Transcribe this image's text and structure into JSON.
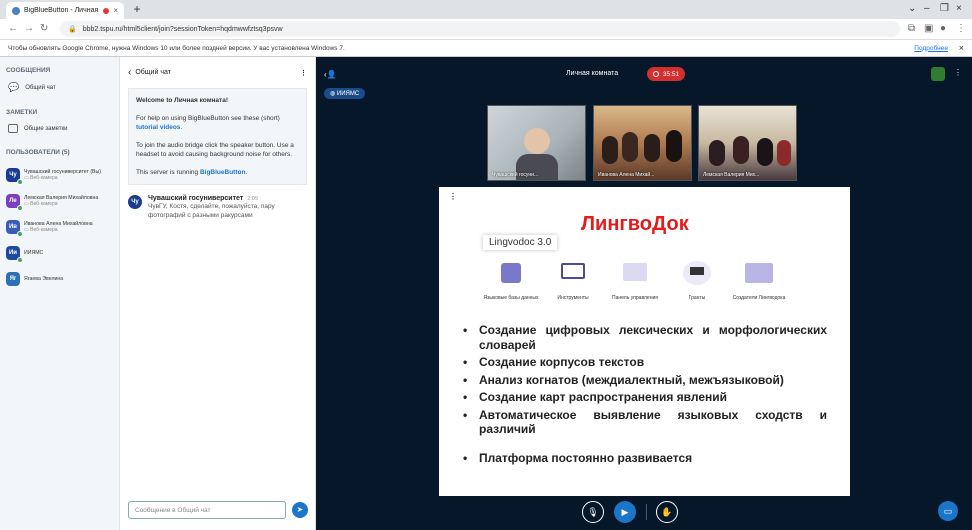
{
  "browser": {
    "tab_title": "BigBlueButton - Личная ком...",
    "tab_close": "×",
    "new_tab": "+",
    "url": "bbb2.tspu.ru/html5client/join?sessionToken=hqdmwwfztsq3psvw",
    "infobar_text": "Чтобы обновлять Google Chrome, нужна Windows 10 или более поздней версии. У вас установлена Windows 7.",
    "infobar_link": "Подробнее"
  },
  "sidebar": {
    "messages_header": "СООБЩЕНИЯ",
    "public_chat": "Общий чат",
    "notes_header": "ЗАМЕТКИ",
    "shared_notes": "Общие заметки",
    "users_header": "ПОЛЬЗОВАТЕЛИ (5)",
    "users": [
      {
        "initials": "Чу",
        "name": "Чувашский госуниверситет (Вы)",
        "sub": "Веб-камера",
        "color": "#1a3d8f"
      },
      {
        "initials": "Ле",
        "name": "Лемская Валерия Михайловна",
        "sub": "Веб-камера",
        "color": "#7b3fbf"
      },
      {
        "initials": "Ив",
        "name": "Иванова Алена Михайловна",
        "sub": "Веб-камера",
        "color": "#3b5bb5"
      },
      {
        "initials": "Ии",
        "name": "ИИЯМС",
        "sub": "",
        "color": "#1f4a9c"
      },
      {
        "initials": "Яг",
        "name": "Ягаева Эвелина",
        "sub": "",
        "color": "#2a6fb8"
      }
    ]
  },
  "chat": {
    "back_icon": "‹",
    "title": "Общий чат",
    "menu": "⋮",
    "welcome_prefix": "Welcome to ",
    "welcome_room": "Личная комната",
    "welcome_suffix": "!",
    "help_text": "For help on using BigBlueButton see these (short) ",
    "help_link": "tutorial videos",
    "help_end": ".",
    "audio_text": "To join the audio bridge click the speaker button. Use a headset to avoid causing background noise for others.",
    "server_text": "This server is running ",
    "server_link": "BigBlueButton",
    "server_end": ".",
    "message": {
      "initials": "Чу",
      "author": "Чувашский госуниверситет",
      "time": "2:09",
      "text": "ЧувГУ, Костя, сделайте, пожалуйста, пару фотографий с разными ракурсами"
    },
    "input_placeholder": "Сообщение в Общий чат",
    "send_icon": "➤"
  },
  "main": {
    "room_title": "Личная комната",
    "rec_time": "35:51",
    "room_badge": "ИИЯМС",
    "videos": [
      {
        "name": "Чувашский госуни..."
      },
      {
        "name": "Иванова Алена Михай..."
      },
      {
        "name": "Лемская Валерия Мих..."
      }
    ],
    "slide": {
      "menu": "⋮",
      "title": "ЛингвоДок",
      "app": "Lingvodoc 3.0",
      "features": [
        "Языковые базы данных",
        "Инструменты",
        "Панель управления",
        "Гранты",
        "Создатели Лингводока"
      ],
      "bullets": [
        "Создание цифровых лексических и морфологических словарей",
        "Создание корпусов текстов",
        "Анализ когнатов (междиалектный, межъязыковой)",
        "Создание карт распространения явлений",
        "Автоматическое выявление языковых сходств и различий",
        "Платформа постоянно развивается"
      ],
      "bullet_char": "•"
    }
  },
  "colors": {
    "accent": "#1b75c9",
    "rec": "#d32f2f",
    "main_bg": "#06172a",
    "slide_title": "#e51b1b"
  }
}
